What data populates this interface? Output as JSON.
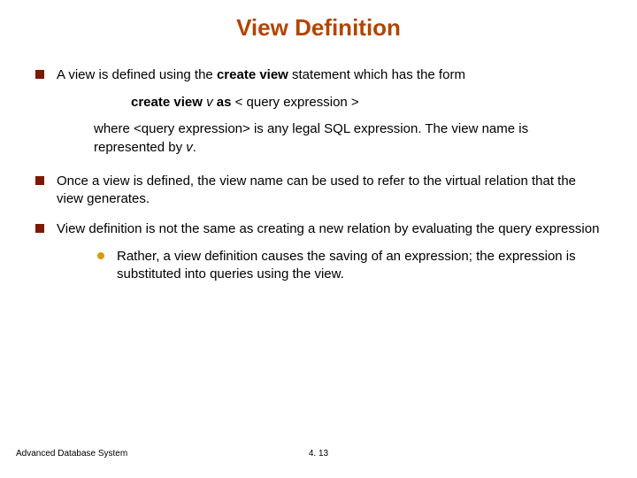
{
  "title": "View Definition",
  "bullets": {
    "b1": {
      "pre": "A view is defined using the ",
      "bold": "create view",
      "post": " statement which has the form"
    },
    "syntax": {
      "bold1": "create view ",
      "ital1": "v ",
      "bold2": "as ",
      "plain": "< query expression >"
    },
    "sub": {
      "line1a": "where <query expression> is any legal SQL expression.  The view name is represented by ",
      "line1b_ital": "v",
      "line1c": "."
    },
    "b2": "Once a view is defined, the view name can be used to refer to the virtual relation that the view generates.",
    "b3": "View definition is not the same as creating a new relation by evaluating the query expression",
    "b3sub": "Rather, a view definition causes the saving of an expression; the expression is substituted into queries using the view."
  },
  "footer": {
    "left": "Advanced Database System",
    "center": "4. 13"
  }
}
